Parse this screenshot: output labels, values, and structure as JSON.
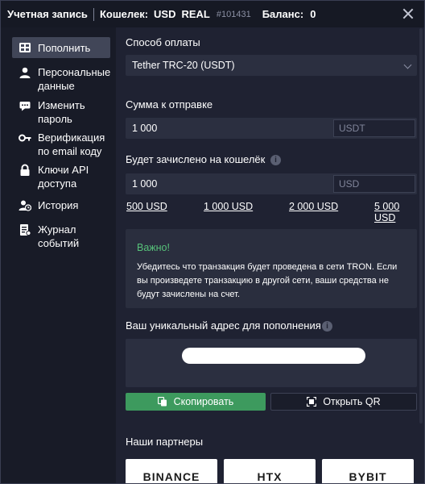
{
  "header": {
    "title": "Учетная запись",
    "wallet_label": "Кошелек:",
    "currency": "USD",
    "account_type": "REAL",
    "account_id": "#101431",
    "balance_label": "Баланс:",
    "balance_value": "0"
  },
  "sidebar": {
    "items": [
      {
        "label": "Пополнить",
        "icon": "deposit-icon",
        "active": true
      },
      {
        "label": "Персональные данные",
        "icon": "user-icon"
      },
      {
        "label": "Изменить пароль",
        "icon": "password-icon"
      },
      {
        "label": "Верификация по email коду",
        "icon": "key-icon"
      },
      {
        "label": "Ключи API доступа",
        "icon": "lock-icon"
      },
      {
        "label": "История",
        "icon": "history-icon"
      },
      {
        "label": "Журнал событий",
        "icon": "log-icon"
      }
    ]
  },
  "payment": {
    "method_label": "Способ оплаты",
    "method_value": "Tether TRC-20 (USDT)",
    "amount_label": "Сумма к отправке",
    "amount_value": "1 000",
    "amount_currency": "USDT",
    "credited_label": "Будет зачислено на кошелёк",
    "credited_value": "1 000",
    "credited_currency": "USD",
    "quick_amounts": [
      "500 USD",
      "1 000 USD",
      "2 000 USD",
      "5 000 USD"
    ]
  },
  "notice": {
    "title": "Важно!",
    "body": "Убедитесь что транзакция будет проведена в сети TRON. Если вы произведете транзакцию в другой сети, ваши средства не будут зачислены на счет."
  },
  "address": {
    "label": "Ваш уникальный адрес для пополнения",
    "copy_label": "Скопировать",
    "qr_label": "Открыть QR"
  },
  "partners": {
    "label": "Наши партнеры",
    "names": [
      "BINANCE",
      "HTX",
      "BYBIT"
    ]
  },
  "colors": {
    "accent_green": "#3d9a5e",
    "notice_title_green": "#57c27a",
    "background": "#1f2232",
    "sidebar": "#181b27"
  }
}
